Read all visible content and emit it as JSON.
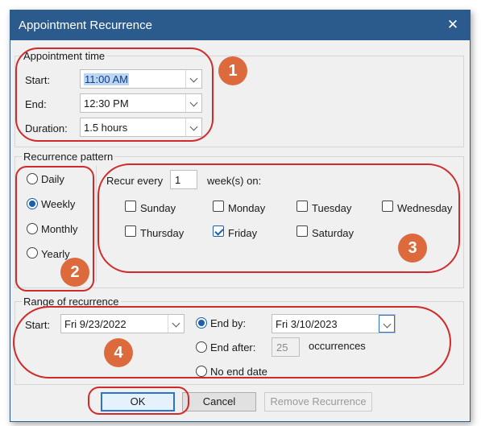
{
  "window": {
    "title": "Appointment Recurrence"
  },
  "appointment_time": {
    "group_label": "Appointment time",
    "start_label": "Start:",
    "start_value": "11:00 AM",
    "end_label": "End:",
    "end_value": "12:30 PM",
    "duration_label": "Duration:",
    "duration_value": "1.5 hours"
  },
  "recurrence_pattern": {
    "group_label": "Recurrence pattern",
    "options": [
      {
        "label": "Daily",
        "selected": false
      },
      {
        "label": "Weekly",
        "selected": true
      },
      {
        "label": "Monthly",
        "selected": false
      },
      {
        "label": "Yearly",
        "selected": false
      }
    ],
    "recur_every_label": "Recur every",
    "recur_every_value": "1",
    "weeks_on_label": "week(s) on:",
    "days": [
      {
        "label": "Sunday",
        "checked": false
      },
      {
        "label": "Monday",
        "checked": false
      },
      {
        "label": "Tuesday",
        "checked": false
      },
      {
        "label": "Wednesday",
        "checked": false
      },
      {
        "label": "Thursday",
        "checked": false
      },
      {
        "label": "Friday",
        "checked": true
      },
      {
        "label": "Saturday",
        "checked": false
      }
    ]
  },
  "range": {
    "group_label": "Range of recurrence",
    "start_label": "Start:",
    "start_value": "Fri 9/23/2022",
    "end_by_label": "End by:",
    "end_by_value": "Fri 3/10/2023",
    "end_after_label": "End after:",
    "end_after_value": "25",
    "occurrences_label": "occurrences",
    "no_end_label": "No end date",
    "selected": "end_by"
  },
  "buttons": {
    "ok": "OK",
    "cancel": "Cancel",
    "remove": "Remove Recurrence"
  },
  "annotations": {
    "m1": "1",
    "m2": "2",
    "m3": "3",
    "m4": "4",
    "color": "#d02a2a",
    "marker_color": "#dc6a3c"
  },
  "colors": {
    "titlebar": "#2b5b8c",
    "accent": "#1c5fad"
  }
}
